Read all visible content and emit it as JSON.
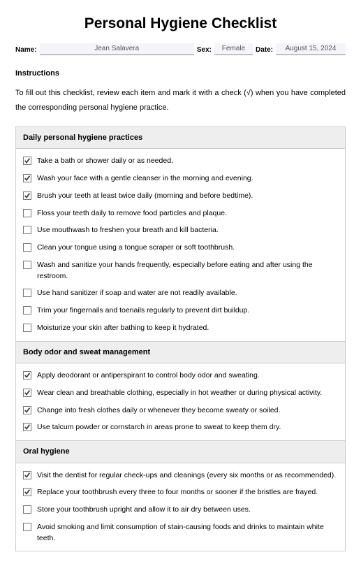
{
  "title": "Personal Hygiene Checklist",
  "meta": {
    "name_label": "Name:",
    "name_value": "Jean Salavera",
    "sex_label": "Sex:",
    "sex_value": "Female",
    "date_label": "Date:",
    "date_value": "August 15, 2024"
  },
  "instructions": {
    "heading": "Instructions",
    "body": "To fill out this checklist, review each item and mark it with a check (√) when you have completed the corresponding personal hygiene practice."
  },
  "sections": [
    {
      "title": "Daily personal hygiene practices",
      "items": [
        {
          "checked": true,
          "text": "Take a bath or shower daily or as needed."
        },
        {
          "checked": true,
          "text": "Wash your face with a gentle cleanser in the morning and evening."
        },
        {
          "checked": true,
          "text": "Brush your teeth at least twice daily (morning and before bedtime)."
        },
        {
          "checked": false,
          "text": "Floss your teeth daily to remove food particles and plaque."
        },
        {
          "checked": false,
          "text": "Use mouthwash to freshen your breath and kill bacteria."
        },
        {
          "checked": false,
          "text": "Clean your tongue using a tongue scraper or soft toothbrush."
        },
        {
          "checked": false,
          "text": "Wash and sanitize your hands frequently, especially before eating and after using the restroom."
        },
        {
          "checked": false,
          "text": "Use hand sanitizer if soap and water are not readily available."
        },
        {
          "checked": false,
          "text": "Trim your fingernails and toenails regularly to prevent dirt buildup."
        },
        {
          "checked": false,
          "text": "Moisturize your skin after bathing to keep it hydrated."
        }
      ]
    },
    {
      "title": "Body odor and sweat management",
      "items": [
        {
          "checked": true,
          "text": "Apply deodorant or antiperspirant to control body odor and sweating."
        },
        {
          "checked": true,
          "text": "Wear clean and breathable clothing, especially in hot weather or during physical activity."
        },
        {
          "checked": true,
          "text": "Change into fresh clothes daily or whenever they become sweaty or soiled."
        },
        {
          "checked": true,
          "text": "Use talcum powder or cornstarch in areas prone to sweat to keep them dry."
        }
      ]
    },
    {
      "title": "Oral hygiene",
      "items": [
        {
          "checked": true,
          "text": "Visit the dentist for regular check-ups and cleanings (every six months or as recommended)."
        },
        {
          "checked": true,
          "text": "Replace your toothbrush every three to four months or sooner if the bristles are frayed."
        },
        {
          "checked": false,
          "text": "Store your toothbrush upright and allow it to air dry between uses."
        },
        {
          "checked": false,
          "text": "Avoid smoking and limit consumption of stain-causing foods and drinks to maintain white teeth."
        }
      ]
    }
  ]
}
